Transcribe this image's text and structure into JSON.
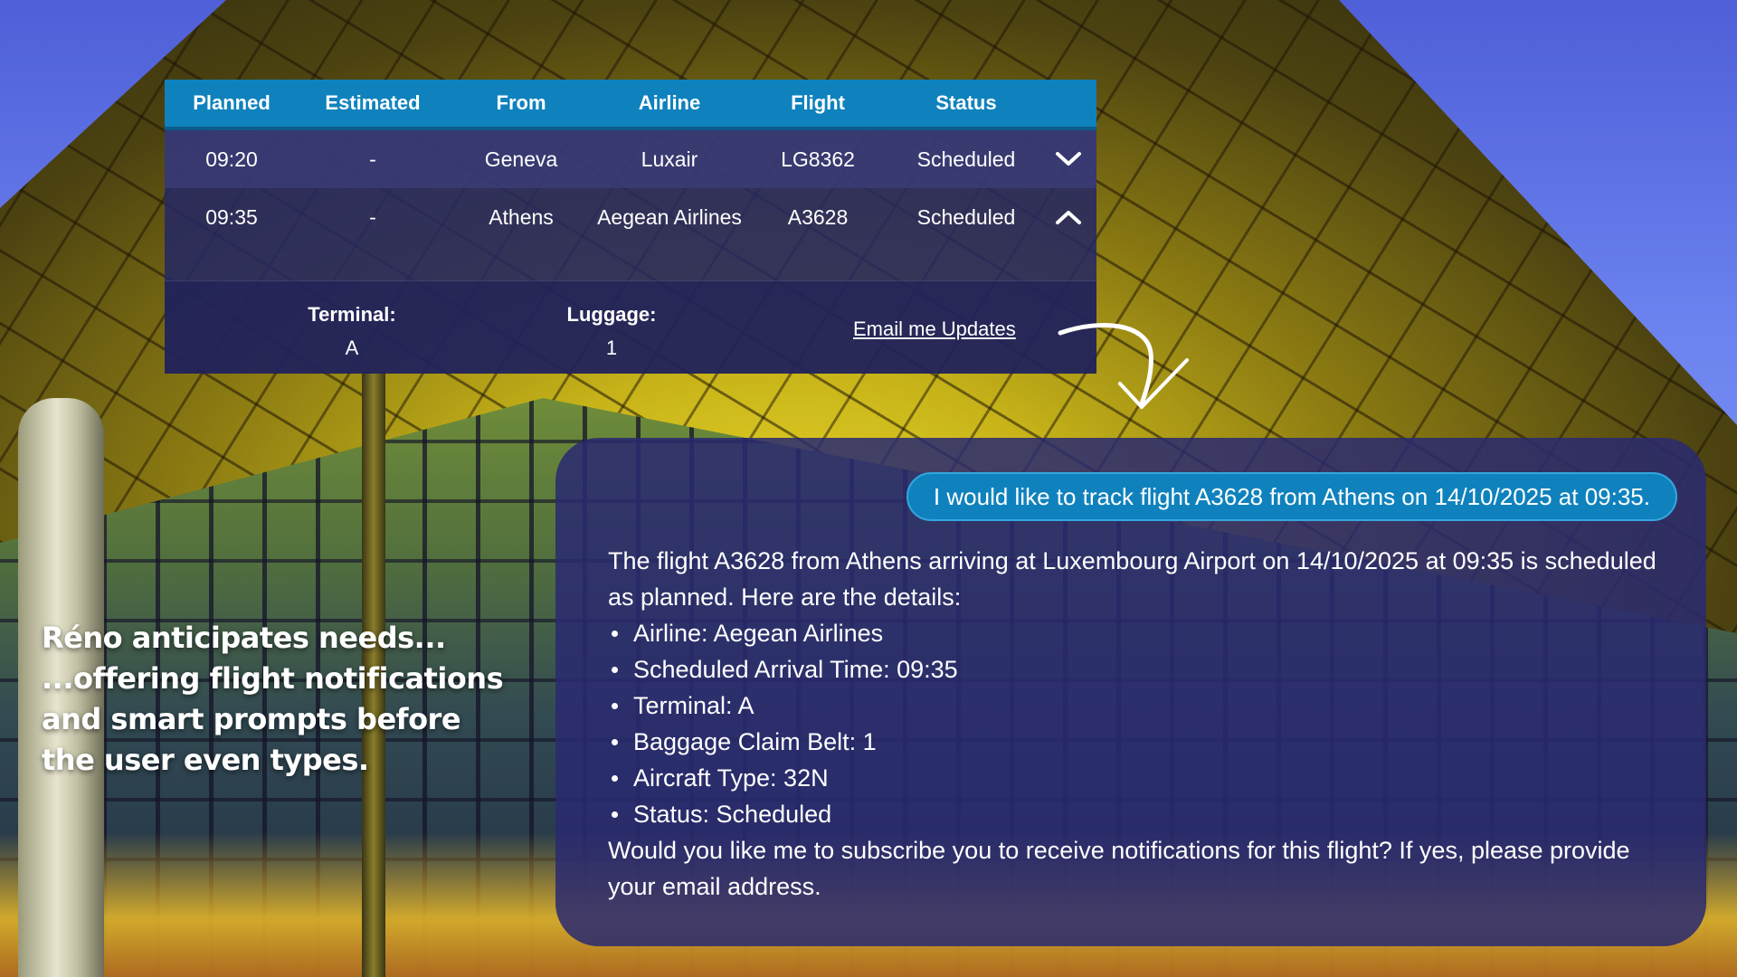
{
  "board": {
    "headers": {
      "planned": "Planned",
      "estimated": "Estimated",
      "from": "From",
      "airline": "Airline",
      "flight": "Flight",
      "status": "Status"
    },
    "rows": [
      {
        "planned": "09:20",
        "estimated": "-",
        "from": "Geneva",
        "airline": "Luxair",
        "flight": "LG8362",
        "status": "Scheduled",
        "toggle_icon": "chevron-down-icon"
      },
      {
        "planned": "09:35",
        "estimated": "-",
        "from": "Athens",
        "airline": "Aegean Airlines",
        "flight": "A3628",
        "status": "Scheduled",
        "toggle_icon": "chevron-up-icon"
      }
    ],
    "details": {
      "terminal_label": "Terminal:",
      "terminal_value": "A",
      "luggage_label": "Luggage:",
      "luggage_value": "1",
      "email_link": "Email me Updates"
    },
    "colors": {
      "header_bg": "#0f82bd",
      "row_bg": "#26286288"
    }
  },
  "chat": {
    "user_message": "I would like to track flight A3628 from Athens on 14/10/2025 at 09:35.",
    "reply_intro": "The flight A3628 from Athens arriving at Luxembourg Airport on 14/10/2025 at 09:35 is scheduled as planned. Here are the details:",
    "reply_items": [
      "Airline: Aegean Airlines",
      "Scheduled Arrival Time: 09:35",
      "Terminal: A",
      "Baggage Claim Belt: 1",
      "Aircraft Type: 32N",
      "Status: Scheduled"
    ],
    "reply_outro": "Would you like me to subscribe you to receive notifications for this flight? If yes, please provide your email address.",
    "colors": {
      "bubble": "#0f82bd",
      "panel": "#2a2a70"
    }
  },
  "caption": {
    "lines": [
      "Réno anticipates needs...",
      "...offering flight notifications",
      "and smart prompts before",
      "the user even types."
    ]
  },
  "icons": {
    "arrow": "curved-arrow-icon"
  }
}
